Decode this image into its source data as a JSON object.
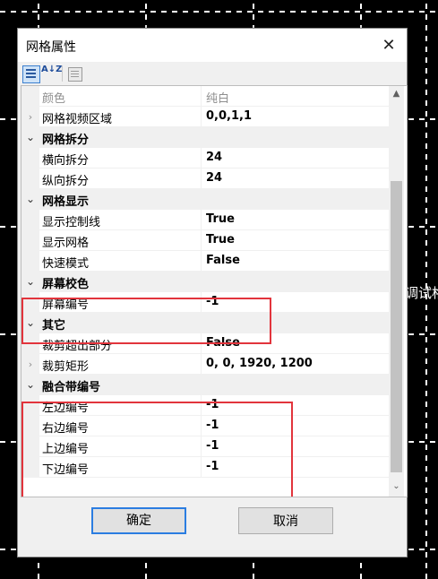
{
  "background": {
    "partial_text": "调试格"
  },
  "dialog": {
    "title": "网格属性",
    "close_symbol": "✕",
    "toolbar": {
      "sort_alpha_label": "A↓Z"
    },
    "rows": [
      {
        "type": "prop",
        "name": "颜色",
        "value": "纯白",
        "dimmed": true,
        "expander": ""
      },
      {
        "type": "prop",
        "name": "网格视频区域",
        "value": "0,0,1,1",
        "expander": "›"
      },
      {
        "type": "category",
        "name": "网格拆分",
        "expander": "⌄"
      },
      {
        "type": "prop",
        "name": "横向拆分",
        "value": "24"
      },
      {
        "type": "prop",
        "name": "纵向拆分",
        "value": "24"
      },
      {
        "type": "category",
        "name": "网格显示",
        "expander": "⌄"
      },
      {
        "type": "prop",
        "name": "显示控制线",
        "value": "True"
      },
      {
        "type": "prop",
        "name": "显示网格",
        "value": "True"
      },
      {
        "type": "prop",
        "name": "快速模式",
        "value": "False"
      },
      {
        "type": "category",
        "name": "屏幕校色",
        "expander": "⌄"
      },
      {
        "type": "prop",
        "name": "屏幕编号",
        "value": "-1"
      },
      {
        "type": "category",
        "name": "其它",
        "expander": "⌄"
      },
      {
        "type": "prop",
        "name": "裁剪超出部分",
        "value": "False"
      },
      {
        "type": "prop",
        "name": "裁剪矩形",
        "value": "0, 0, 1920, 1200",
        "expander": "›"
      },
      {
        "type": "category",
        "name": "融合带编号",
        "expander": "⌄"
      },
      {
        "type": "prop",
        "name": "左边编号",
        "value": "-1"
      },
      {
        "type": "prop",
        "name": "右边编号",
        "value": "-1"
      },
      {
        "type": "prop",
        "name": "上边编号",
        "value": "-1"
      },
      {
        "type": "prop",
        "name": "下边编号",
        "value": "-1"
      }
    ],
    "scrollbar": {
      "up": "▲",
      "down": "⌄"
    },
    "buttons": {
      "ok": "确定",
      "cancel": "取消"
    },
    "highlight_color": "#e2343c",
    "accent_color": "#2b7de1"
  }
}
